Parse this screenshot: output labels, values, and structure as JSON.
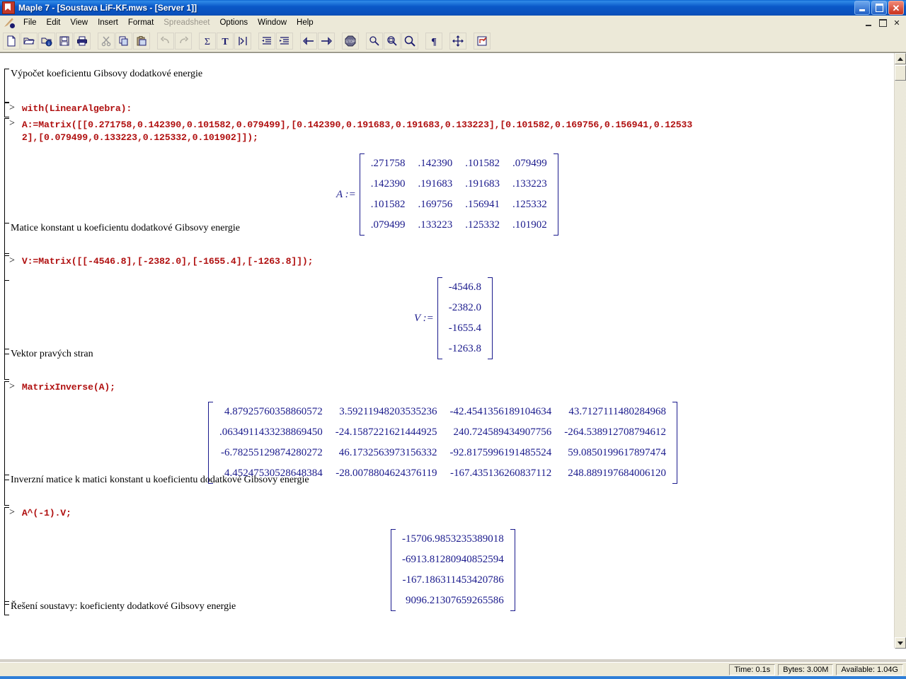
{
  "window": {
    "title": "Maple 7  - [Soustava LiF-KF.mws - [Server 1]]",
    "app_icon": "maple-leaf-icon",
    "minimize_label": "Minimize",
    "maximize_label": "Maximize",
    "close_label": "Close"
  },
  "menubar": {
    "items": [
      {
        "label": "File",
        "disabled": false
      },
      {
        "label": "Edit",
        "disabled": false
      },
      {
        "label": "View",
        "disabled": false
      },
      {
        "label": "Insert",
        "disabled": false
      },
      {
        "label": "Format",
        "disabled": false
      },
      {
        "label": "Spreadsheet",
        "disabled": true
      },
      {
        "label": "Options",
        "disabled": false
      },
      {
        "label": "Window",
        "disabled": false
      },
      {
        "label": "Help",
        "disabled": false
      }
    ],
    "mdi": {
      "minimize_label": "Minimize Document",
      "restore_label": "Restore Document",
      "close_label": "Close Document"
    }
  },
  "toolbar": {
    "buttons": [
      {
        "name": "new-document-icon",
        "tip": "New"
      },
      {
        "name": "open-document-icon",
        "tip": "Open"
      },
      {
        "name": "open-url-icon",
        "tip": "Open URL"
      },
      {
        "name": "save-icon",
        "tip": "Save"
      },
      {
        "name": "print-icon",
        "tip": "Print"
      },
      {
        "name": "cut-icon",
        "tip": "Cut"
      },
      {
        "name": "copy-icon",
        "tip": "Copy"
      },
      {
        "name": "paste-icon",
        "tip": "Paste"
      },
      {
        "name": "undo-icon",
        "tip": "Undo"
      },
      {
        "name": "redo-icon",
        "tip": "Redo"
      },
      {
        "name": "sigma-math-input-icon",
        "tip": "Insert Maple Input"
      },
      {
        "name": "text-input-icon",
        "tip": "Insert Text"
      },
      {
        "name": "execute-prompt-icon",
        "tip": "Insert Execution Group"
      },
      {
        "name": "unindent-icon",
        "tip": "Remove Section"
      },
      {
        "name": "indent-icon",
        "tip": "Insert Section"
      },
      {
        "name": "back-arrow-icon",
        "tip": "Back"
      },
      {
        "name": "forward-arrow-icon",
        "tip": "Forward"
      },
      {
        "name": "stop-icon",
        "tip": "Stop"
      },
      {
        "name": "zoom-out-icon",
        "tip": "Zoom Out"
      },
      {
        "name": "zoom-fit-icon",
        "tip": "Zoom 100%"
      },
      {
        "name": "zoom-in-icon",
        "tip": "Zoom In"
      },
      {
        "name": "show-paragraph-marks-icon",
        "tip": "Nonprintable Characters"
      },
      {
        "name": "move-resize-icon",
        "tip": "Restart"
      },
      {
        "name": "export-icon",
        "tip": "Export"
      }
    ]
  },
  "worksheet": {
    "groups": [
      {
        "kind": "text",
        "name": "text-vypocet",
        "text": "Výpočet koeficientu Gibsovy dodatkové energie"
      },
      {
        "kind": "input",
        "name": "input-with-linearalgebra",
        "prompt": ">",
        "lines": [
          "with(LinearAlgebra):"
        ]
      },
      {
        "kind": "input-output",
        "name": "input-matrix-a",
        "prompt": ">",
        "lines": [
          "A:=Matrix([[0.271758,0.142390,0.101582,0.079499],[0.142390,0.191683,0.191683,0.133223],[0.101582,0.169756,0.156941,0.12533",
          "2],[0.079499,0.133223,0.125332,0.101902]]);"
        ],
        "output": {
          "label": "A :=",
          "rows": [
            [
              ".271758",
              ".142390",
              ".101582",
              ".079499"
            ],
            [
              ".142390",
              ".191683",
              ".191683",
              ".133223"
            ],
            [
              ".101582",
              ".169756",
              ".156941",
              ".125332"
            ],
            [
              ".079499",
              ".133223",
              ".125332",
              ".101902"
            ]
          ]
        }
      },
      {
        "kind": "text",
        "name": "text-matice-konstant",
        "text": "Matice konstant u koeficientu dodatkové Gibsovy energie"
      },
      {
        "kind": "input-output",
        "name": "input-matrix-v",
        "prompt": ">",
        "lines": [
          "V:=Matrix([[-4546.8],[-2382.0],[-1655.4],[-1263.8]]);"
        ],
        "output": {
          "label": "V :=",
          "rows": [
            [
              "-4546.8"
            ],
            [
              "-2382.0"
            ],
            [
              "-1655.4"
            ],
            [
              "-1263.8"
            ]
          ]
        }
      },
      {
        "kind": "text",
        "name": "text-vektor-pravych-stran",
        "text": "Vektor pravých stran"
      },
      {
        "kind": "input-output",
        "name": "input-matrixinverse",
        "prompt": ">",
        "lines": [
          "MatrixInverse(A);"
        ],
        "output": {
          "label": "",
          "rows": [
            [
              "4.87925760358860572",
              "3.59211948203535236",
              "-42.4541356189104634",
              "43.7127111480284968"
            ],
            [
              ".0634911433238869450",
              "-24.1587221621444925",
              "240.724589434907756",
              "-264.538912708794612"
            ],
            [
              "-6.78255129874280272",
              "46.1732563973156332",
              "-92.8175996191485524",
              "59.0850199617897474"
            ],
            [
              "4.45247530528648384",
              "-28.0078804624376119",
              "-167.435136260837112",
              "248.889197684006120"
            ]
          ]
        }
      },
      {
        "kind": "text",
        "name": "text-inverzni-matice",
        "text": "Inverzní matice k matici konstant u koeficientu dodatkové Gibsovy energie"
      },
      {
        "kind": "input-output",
        "name": "input-solve",
        "prompt": ">",
        "lines": [
          "A^(-1).V;"
        ],
        "output": {
          "label": "",
          "rows": [
            [
              "-15706.9853235389018"
            ],
            [
              "-6913.81280940852594"
            ],
            [
              "-167.186311453420786"
            ],
            [
              "9096.21307659265586"
            ]
          ]
        }
      },
      {
        "kind": "text",
        "name": "text-reseni-soustavy",
        "text": "Řešení soustavy: koeficienty dodatkové Gibsovy energie"
      }
    ]
  },
  "statusbar": {
    "time": "Time:   0.1s",
    "bytes": "Bytes: 3.00M",
    "available": "Available: 1.04G"
  },
  "colors": {
    "input_red": "#b01010",
    "output_blue": "#1a1a8c",
    "title_blue": "#0a58c8",
    "chrome": "#ece9d8"
  }
}
